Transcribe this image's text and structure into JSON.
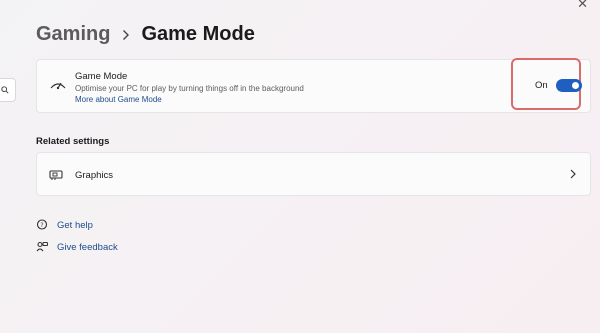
{
  "breadcrumb": {
    "parent": "Gaming",
    "current": "Game Mode"
  },
  "game_mode_card": {
    "title": "Game Mode",
    "description": "Optimise your PC for play by turning things off in the background",
    "link": "More about Game Mode",
    "toggle_label": "On",
    "toggle_state": true
  },
  "related": {
    "heading": "Related settings",
    "items": [
      {
        "label": "Graphics"
      }
    ]
  },
  "help_links": [
    {
      "label": "Get help"
    },
    {
      "label": "Give feedback"
    }
  ],
  "colors": {
    "accent": "#1f5fbf",
    "link": "#1f4c8c",
    "highlight_border": "#d96b6b"
  }
}
